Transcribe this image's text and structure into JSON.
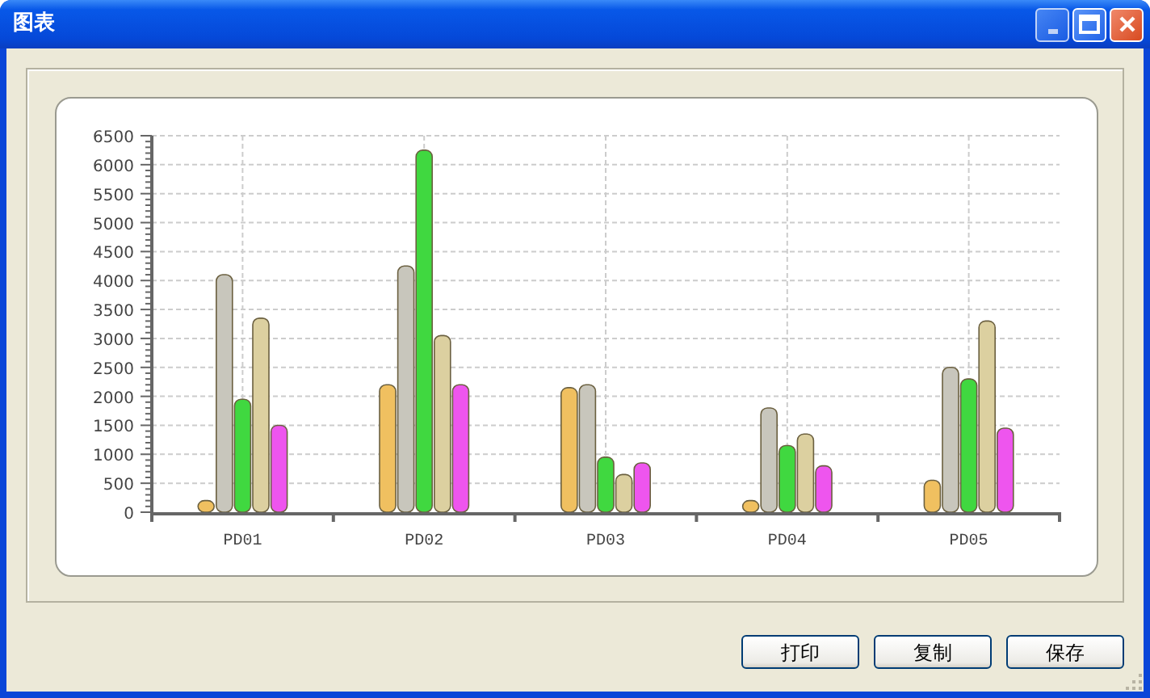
{
  "window": {
    "title": "图表"
  },
  "chart": {
    "chart_data": {
      "type": "bar",
      "categories": [
        "PD01",
        "PD02",
        "PD03",
        "PD04",
        "PD05"
      ],
      "series": [
        {
          "color": "#f0c060",
          "values": [
            200,
            2200,
            2150,
            200,
            550
          ]
        },
        {
          "color": "#c8c6bc",
          "values": [
            4100,
            4250,
            2200,
            1800,
            2500
          ]
        },
        {
          "color": "#40d840",
          "values": [
            1950,
            6250,
            950,
            1150,
            2300
          ]
        },
        {
          "color": "#dcd0a0",
          "values": [
            3350,
            3050,
            650,
            1350,
            3300
          ]
        },
        {
          "color": "#ee55ee",
          "values": [
            1500,
            2200,
            850,
            800,
            1450
          ]
        }
      ],
      "grid": true,
      "ylim": [
        0,
        6500
      ],
      "yticks": [
        0,
        500,
        1000,
        1500,
        2000,
        2500,
        3000,
        3500,
        4000,
        4500,
        5000,
        5500,
        6000,
        6500
      ]
    }
  },
  "buttons": [
    "打印",
    "复制",
    "保存"
  ]
}
